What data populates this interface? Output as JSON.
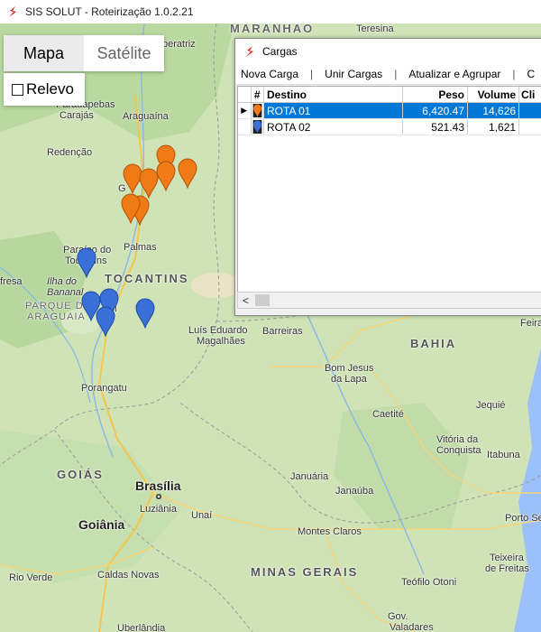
{
  "app": {
    "title": "SIS SOLUT - Roteirização 1.0.2.21"
  },
  "map_controls": {
    "map_label": "Mapa",
    "satellite_label": "Satélite",
    "relief_label": "Relevo",
    "relief_checked": false
  },
  "map_labels": {
    "maranhao": "MARANHÃO",
    "teresina": "Teresina",
    "imperatriz": "peratriz",
    "carajas": "Carajás",
    "parauapebas": "Parauapebas",
    "araguaina": "Araguaína",
    "redencao": "Redenção",
    "gurupi_top": "G",
    "palmas": "Palmas",
    "paraiso": "Paraíso do",
    "tocantins_city": "Tocantins",
    "tocantins": "TOCANTINS",
    "frescal": "fresa",
    "ilha1": "Ilha do",
    "ilha2": "Bananal",
    "parque1": "PARQUE DO",
    "parque2": "ARAGUAIA",
    "gurupi": "pi",
    "luis1": "Luís Eduardo",
    "luis2": "Magalhães",
    "barreiras": "Barreiras",
    "bahia": "BAHIA",
    "feira": "Feira",
    "bomjesus1": "Bom Jesus",
    "bomjesus2": "da Lapa",
    "porangatu": "Porangatu",
    "caetite": "Caetité",
    "jequie": "Jequié",
    "vitoria1": "Vitória da",
    "vitoria2": "Conquista",
    "itabuna": "Itabuna",
    "goias": "GOIÁS",
    "brasilia": "Brasília",
    "luziania": "Luziânia",
    "januaria": "Januária",
    "janauba": "Janaúba",
    "goiania": "Goiânia",
    "unai": "Unaí",
    "montes": "Montes Claros",
    "porto": "Porto Se",
    "teixeira1": "Teixeira",
    "teixeira2": "de Freitas",
    "rioverde": "Rio Verde",
    "caldas": "Caldas Novas",
    "minas": "MINAS GERAIS",
    "teofilo": "Teófilo Otoni",
    "govvaladares1": "Gov.",
    "govvaladares2": "Valadares",
    "uberlandia": "Uberlândia"
  },
  "markers": {
    "orange_color": "#f07b16",
    "blue_color": "#3a6fd8",
    "routes": [
      "ROTA 01",
      "ROTA 02"
    ]
  },
  "window": {
    "title": "Cargas",
    "menu": [
      "Nova Carga",
      "Unir Cargas",
      "Atualizar e Agrupar",
      "C"
    ],
    "columns": [
      "#",
      "Destino",
      "Peso",
      "Volume",
      "Cli"
    ],
    "rows": [
      {
        "destino": "ROTA 01",
        "peso": "6,420.47",
        "volume": "14,626",
        "color": "#f07b16"
      },
      {
        "destino": "ROTA 02",
        "peso": "521.43",
        "volume": "1,621",
        "color": "#3a6fd8"
      }
    ],
    "scroll_left": "<"
  }
}
